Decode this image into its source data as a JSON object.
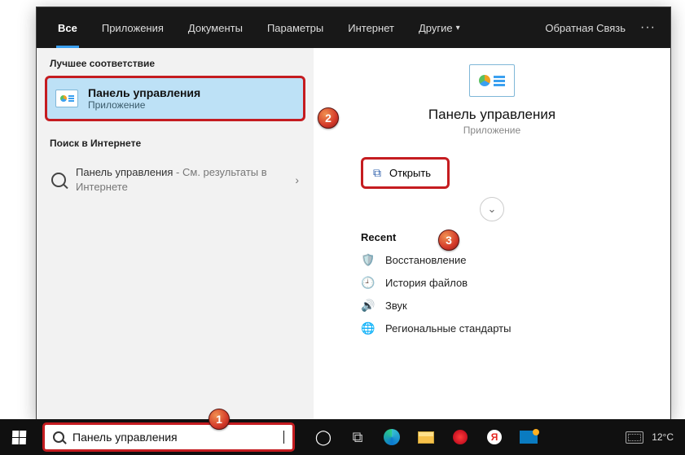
{
  "tabs": {
    "all": "Все",
    "apps": "Приложения",
    "docs": "Документы",
    "settings": "Параметры",
    "internet": "Интернет",
    "more": "Другие",
    "feedback": "Обратная Связь"
  },
  "left": {
    "best_label": "Лучшее соответствие",
    "best_title": "Панель управления",
    "best_sub": "Приложение",
    "web_label": "Поиск в Интернете",
    "web_item_main": "Панель управления",
    "web_item_tail": " - См. результаты в Интернете"
  },
  "right": {
    "title": "Панель управления",
    "subtitle": "Приложение",
    "open": "Открыть",
    "recent": "Recent",
    "items": [
      "Восстановление",
      "История файлов",
      "Звук",
      "Региональные стандарты"
    ]
  },
  "search": {
    "value": "Панель управления"
  },
  "temp": "12°C"
}
